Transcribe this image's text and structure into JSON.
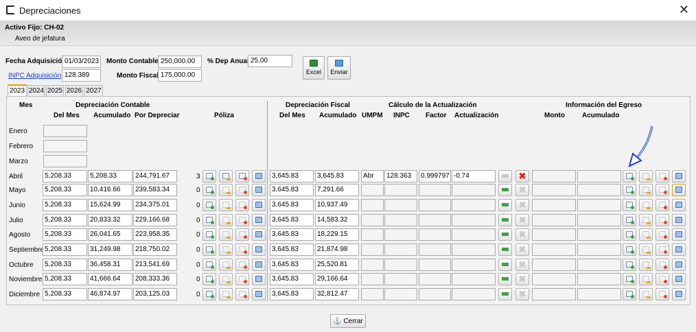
{
  "window": {
    "title": "Depreciaciones"
  },
  "asset": {
    "code": "Activo Fijo: CH-02",
    "description": "Aveo de jefatura"
  },
  "form": {
    "fecha_adquisicion_label": "Fecha Adquisición",
    "fecha_adquisicion": "01/03/2023",
    "monto_contable_label": "Monto Contable",
    "monto_contable": "250,000.00",
    "dep_anual_label": "% Dep Anual",
    "dep_anual": "25.00",
    "inpc_label": "INPC Adquisición",
    "inpc": "128.389",
    "monto_fiscal_label": "Monto Fiscal",
    "monto_fiscal": "175,000.00"
  },
  "buttons": {
    "excel": "Excel",
    "enviar": "Enviar",
    "cerrar": "Cerrar"
  },
  "tabs": [
    "2023",
    "2024",
    "2025",
    "2026",
    "2027"
  ],
  "active_tab": "2023",
  "headers": {
    "mes": "Mes",
    "dep_contable": "Depreciación Contable",
    "del_mes": "Del Mes",
    "acumulado": "Acumulado",
    "por_depreciar": "Por Depreciar",
    "poliza": "Póliza",
    "dep_fiscal": "Depreciación Fiscal",
    "fiscal_del_mes": "Del Mes",
    "fiscal_acumulado": "Acumulado",
    "calculo": "Cálculo de la Actualización",
    "umpm": "UMPM",
    "inpc": "INPC",
    "factor": "Factor",
    "actualizacion": "Actualización",
    "egreso": "Información del Egreso",
    "monto": "Monto",
    "egreso_acumulado": "Acumulado"
  },
  "months": [
    {
      "mes": "Enero"
    },
    {
      "mes": "Febrero"
    },
    {
      "mes": "Marzo"
    },
    {
      "mes": "Abril",
      "del_mes": "5,208.33",
      "acumulado": "5,208.33",
      "por_depreciar": "244,791.67",
      "poliza_count": "3",
      "fiscal_del_mes": "3,645.83",
      "fiscal_acumulado": "3,645.83",
      "umpm": "Abr",
      "inpc": "128.363",
      "factor": "0.999797",
      "actualizacion": "-0.74"
    },
    {
      "mes": "Mayo",
      "del_mes": "5,208.33",
      "acumulado": "10,416.66",
      "por_depreciar": "239,583.34",
      "poliza_count": "0",
      "fiscal_del_mes": "3,645.83",
      "fiscal_acumulado": "7,291.66"
    },
    {
      "mes": "Junio",
      "del_mes": "5,208.33",
      "acumulado": "15,624.99",
      "por_depreciar": "234,375.01",
      "poliza_count": "0",
      "fiscal_del_mes": "3,645.83",
      "fiscal_acumulado": "10,937.49"
    },
    {
      "mes": "Julio",
      "del_mes": "5,208.33",
      "acumulado": "20,833.32",
      "por_depreciar": "229,166.68",
      "poliza_count": "0",
      "fiscal_del_mes": "3,645.83",
      "fiscal_acumulado": "14,583.32"
    },
    {
      "mes": "Agosto",
      "del_mes": "5,208.33",
      "acumulado": "26,041.65",
      "por_depreciar": "223,958.35",
      "poliza_count": "0",
      "fiscal_del_mes": "3,645.83",
      "fiscal_acumulado": "18,229.15"
    },
    {
      "mes": "Septiembre",
      "del_mes": "5,208.33",
      "acumulado": "31,249.98",
      "por_depreciar": "218,750.02",
      "poliza_count": "0",
      "fiscal_del_mes": "3,645.83",
      "fiscal_acumulado": "21,874.98"
    },
    {
      "mes": "Octubre",
      "del_mes": "5,208.33",
      "acumulado": "36,458.31",
      "por_depreciar": "213,541.69",
      "poliza_count": "0",
      "fiscal_del_mes": "3,645.83",
      "fiscal_acumulado": "25,520.81"
    },
    {
      "mes": "Noviembre",
      "del_mes": "5,208.33",
      "acumulado": "41,666.64",
      "por_depreciar": "208,333.36",
      "poliza_count": "0",
      "fiscal_del_mes": "3,645.83",
      "fiscal_acumulado": "29,166.64"
    },
    {
      "mes": "Diciembre",
      "del_mes": "5,208.33",
      "acumulado": "46,874.97",
      "por_depreciar": "203,125.03",
      "poliza_count": "0",
      "fiscal_del_mes": "3,645.83",
      "fiscal_acumulado": "32,812.47"
    }
  ],
  "colors": {
    "tab_accent": "#e0a000",
    "link": "#1a3fd6",
    "delete_active": "#e0281e",
    "annotation_arrow": "#1f3fd0"
  },
  "icons": {
    "poliza": [
      "add-document-icon",
      "edit-document-icon",
      "delete-document-icon",
      "print-icon"
    ],
    "actualizacion": [
      "arrow-right-icon",
      "x-icon"
    ],
    "egreso": [
      "add-document-icon",
      "edit-document-icon",
      "delete-document-icon",
      "print-icon"
    ]
  }
}
